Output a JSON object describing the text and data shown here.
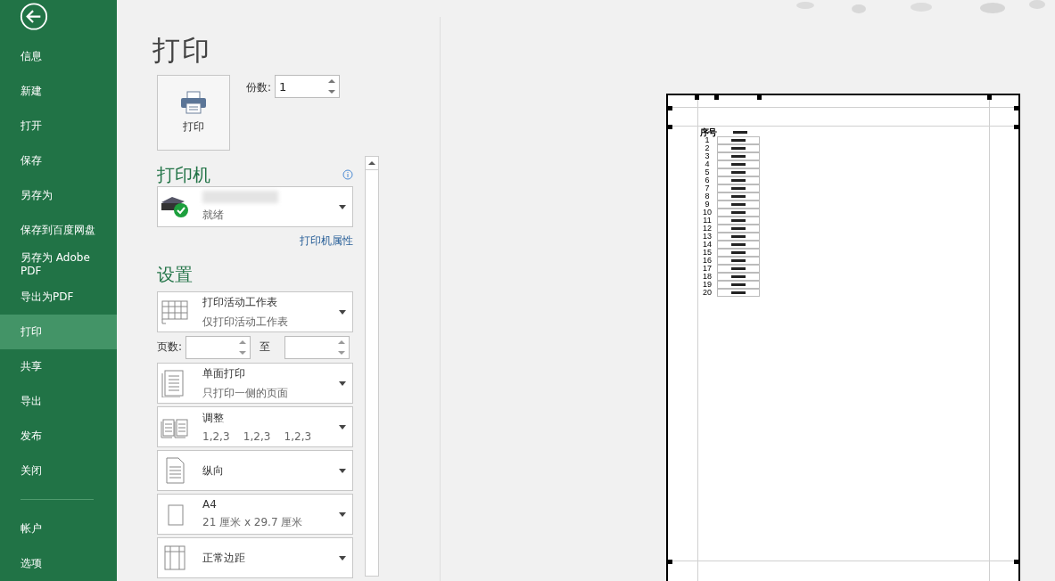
{
  "sidebar": {
    "items": [
      {
        "label": "信息",
        "selected": false
      },
      {
        "label": "新建",
        "selected": false
      },
      {
        "label": "打开",
        "selected": false
      },
      {
        "label": "保存",
        "selected": false
      },
      {
        "label": "另存为",
        "selected": false
      },
      {
        "label": "保存到百度网盘",
        "selected": false
      },
      {
        "label": "另存为 Adobe PDF",
        "selected": false
      },
      {
        "label": "导出为PDF",
        "selected": false
      },
      {
        "label": "打印",
        "selected": true
      },
      {
        "label": "共享",
        "selected": false
      },
      {
        "label": "导出",
        "selected": false
      },
      {
        "label": "发布",
        "selected": false
      },
      {
        "label": "关闭",
        "selected": false
      }
    ],
    "bottom_items": [
      {
        "label": "帐户",
        "selected": false
      },
      {
        "label": "选项",
        "selected": false
      }
    ]
  },
  "title": "打印",
  "print_button": "打印",
  "copies": {
    "label": "份数:",
    "value": "1"
  },
  "printer": {
    "heading": "打印机",
    "status": "就绪",
    "properties_link": "打印机属性"
  },
  "settings": {
    "heading": "设置",
    "options": [
      {
        "kind": "sheet",
        "title": "打印活动工作表",
        "subtitle": "仅打印活动工作表"
      },
      {
        "kind": "pages",
        "label": "页数:",
        "to": "至"
      },
      {
        "kind": "single",
        "title": "单面打印",
        "subtitle": "只打印一侧的页面"
      },
      {
        "kind": "collate",
        "title": "调整",
        "subtitle": "1,2,3    1,2,3    1,2,3"
      },
      {
        "kind": "portrait",
        "title": "纵向"
      },
      {
        "kind": "paper",
        "title": "A4",
        "subtitle": "21 厘米 x 29.7 厘米"
      },
      {
        "kind": "margins",
        "title": "正常边距"
      }
    ]
  },
  "preview": {
    "column_1": "序号",
    "rows": [
      "1",
      "2",
      "3",
      "4",
      "5",
      "6",
      "7",
      "8",
      "9",
      "10",
      "11",
      "12",
      "13",
      "14",
      "15",
      "16",
      "17",
      "18",
      "19",
      "20"
    ]
  }
}
